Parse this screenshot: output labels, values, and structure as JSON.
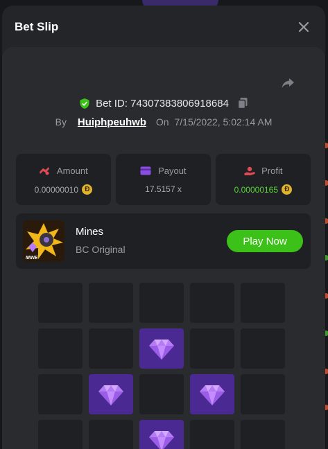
{
  "modal": {
    "title": "Bet Slip",
    "bet_id_label": "Bet ID: 74307383806918684",
    "by_label": "By",
    "username": "Huiphpeuhwb",
    "on_label": "On",
    "datetime": "7/15/2022, 5:02:14 AM"
  },
  "stats": {
    "amount_label": "Amount",
    "amount_value": "0.00000010",
    "payout_label": "Payout",
    "payout_value": "17.5157 x",
    "profit_label": "Profit",
    "profit_value": "0.00000165",
    "coin_symbol": "Đ"
  },
  "game": {
    "name": "Mines",
    "subtitle": "BC Original",
    "play_label": "Play Now",
    "thumb_text": "MINE"
  },
  "grid": {
    "columns": 5,
    "rows_visible": 4,
    "tiles": [
      "empty",
      "empty",
      "empty",
      "empty",
      "empty",
      "empty",
      "empty",
      "gem",
      "empty",
      "empty",
      "empty",
      "gem",
      "empty",
      "gem",
      "empty",
      "empty",
      "empty",
      "gem",
      "empty",
      "empty"
    ]
  },
  "colors": {
    "accent_green": "#3bc117",
    "gem_purple": "#4a2a92",
    "profit_green": "#5bd33a",
    "coin_gold": "#e0b32a"
  }
}
